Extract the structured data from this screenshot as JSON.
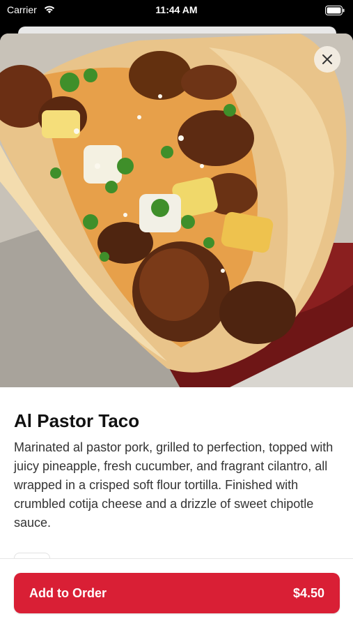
{
  "status_bar": {
    "carrier": "Carrier",
    "time": "11:44 AM"
  },
  "item": {
    "title": "Al Pastor Taco",
    "description": "Marinated al pastor pork, grilled to perfection, topped with juicy pineapple, fresh cucumber, and fragrant cilantro, all wrapped in a crisped soft flour tortilla. Finished with crumbled cotija cheese and a drizzle of sweet chipotle sauce.",
    "image_icon": "taco-photo"
  },
  "actions": {
    "add_label": "Add to Order",
    "price": "$4.50",
    "close_icon": "close-icon"
  },
  "colors": {
    "accent": "#d91f35",
    "background": "#ffffff"
  }
}
